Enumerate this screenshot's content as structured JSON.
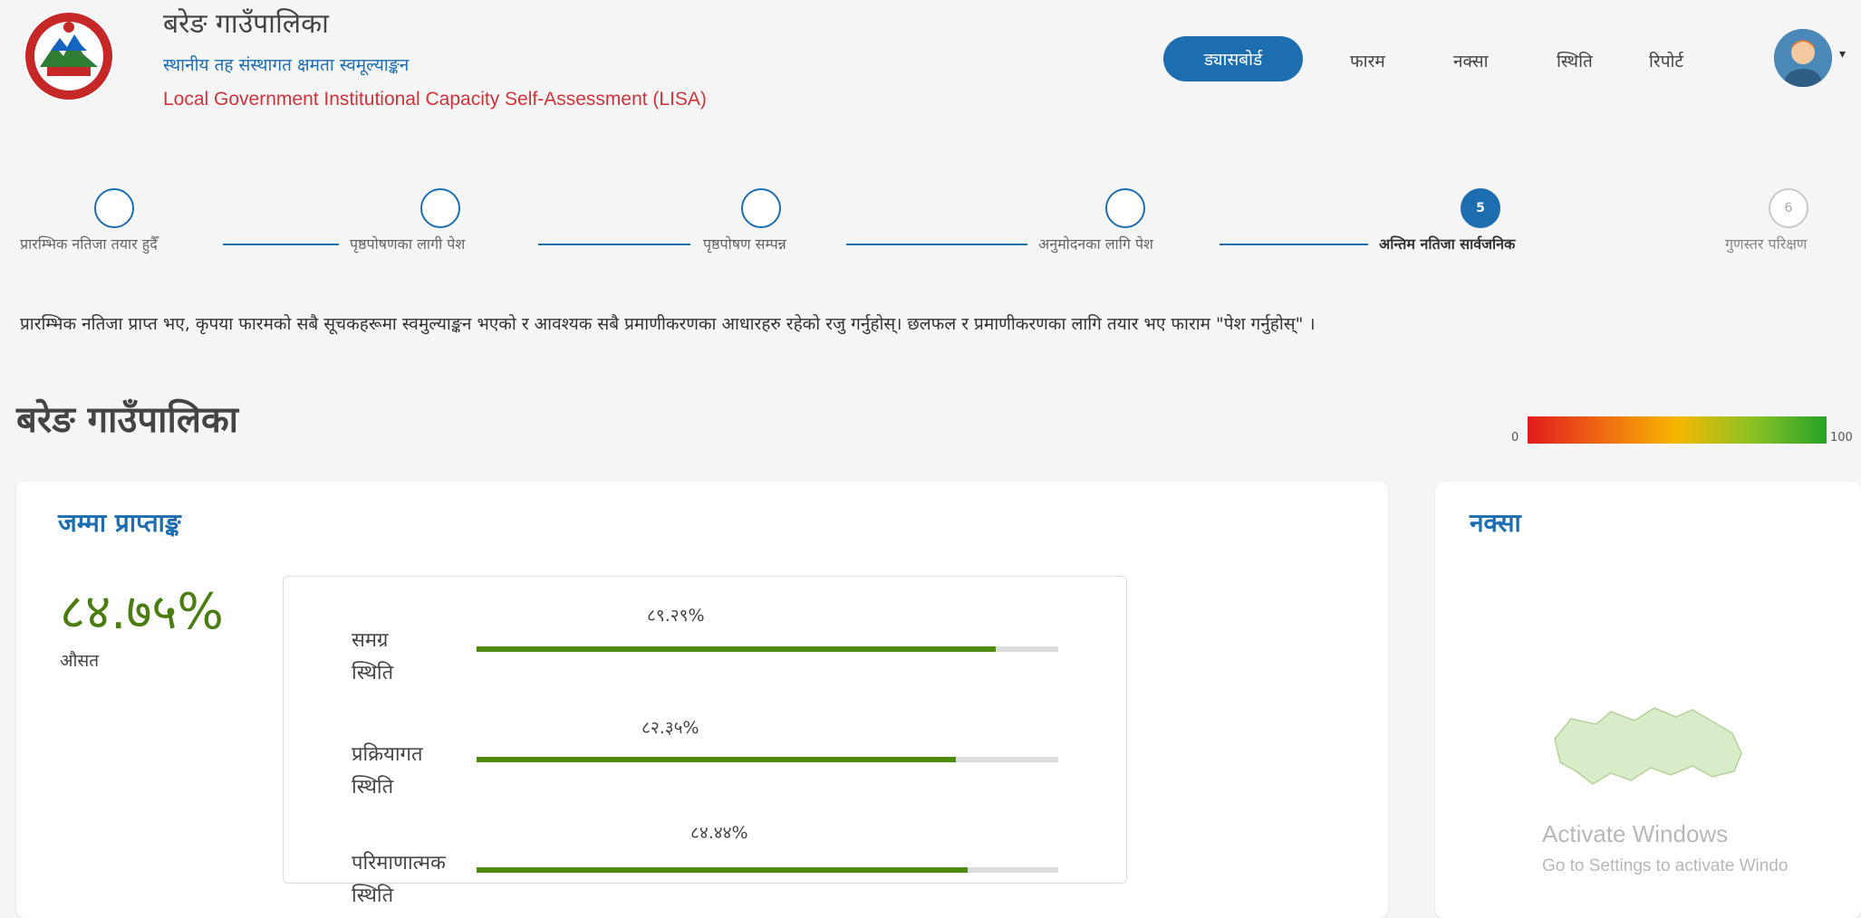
{
  "header": {
    "title": "बरेङ गाउँपालिका",
    "subtitle_np": "स्थानीय तह संस्थागत क्षमता स्वमूल्याङ्कन",
    "subtitle_en": "Local Government Institutional Capacity Self-Assessment (LISA)"
  },
  "nav": {
    "dashboard": "ड्यासबोर्ड",
    "form": "फारम",
    "map": "नक्सा",
    "status": "स्थिति",
    "report": "रिपोर्ट"
  },
  "stepper": {
    "steps": [
      {
        "label": "प्रारम्भिक नतिजा तयार हुदैँ",
        "number": "",
        "state": "done"
      },
      {
        "label": "पृष्ठपोषणका लागी पेश",
        "number": "",
        "state": "done"
      },
      {
        "label": "पृष्ठपोषण सम्पन्न",
        "number": "",
        "state": "done"
      },
      {
        "label": "अनुमोदनका लागि पेश",
        "number": "",
        "state": "done"
      },
      {
        "label": "अन्तिम नतिजा सार्वजनिक",
        "number": "5",
        "state": "active"
      },
      {
        "label": "गुणस्तर परिक्षण",
        "number": "6",
        "state": "future"
      }
    ]
  },
  "notice": "प्रारम्भिक नतिजा प्राप्त भए, कृपया फारमको सबै सूचकहरूमा स्वमुल्याङ्कन भएको र आवश्यक सबै प्रमाणीकरणका आधारहरु रहेको रजु गर्नुहोस्। छलफल र प्रमाणीकरणका लागि तयार भए फाराम \"पेश गर्नुहोस्\" ।",
  "municipality": "बरेङ गाउँपालिका",
  "legend": {
    "min": "0",
    "max": "100",
    "colors": [
      "#e01c1c",
      "#ef6a12",
      "#f5b700",
      "#8bc226",
      "#26a326"
    ]
  },
  "score_card": {
    "title": "जम्मा प्राप्ताङ्क",
    "total": "८४.७५%",
    "total_label": "औसत",
    "bars": [
      {
        "label_line1": "समग्र",
        "label_line2": "स्थिति",
        "value_text": "८९.२९%",
        "value": 89.29
      },
      {
        "label_line1": "प्रक्रियागत",
        "label_line2": "स्थिति",
        "value_text": "८२.३५%",
        "value": 82.35
      },
      {
        "label_line1": "परिमाणात्मक",
        "label_line2": "स्थिति",
        "value_text": "८४.४४%",
        "value": 84.44
      }
    ],
    "bar_color": "#4f8a10"
  },
  "map_card": {
    "title": "नक्सा"
  },
  "watermark": {
    "line1": "Activate Windows",
    "line2": "Go to Settings to activate Windo"
  }
}
